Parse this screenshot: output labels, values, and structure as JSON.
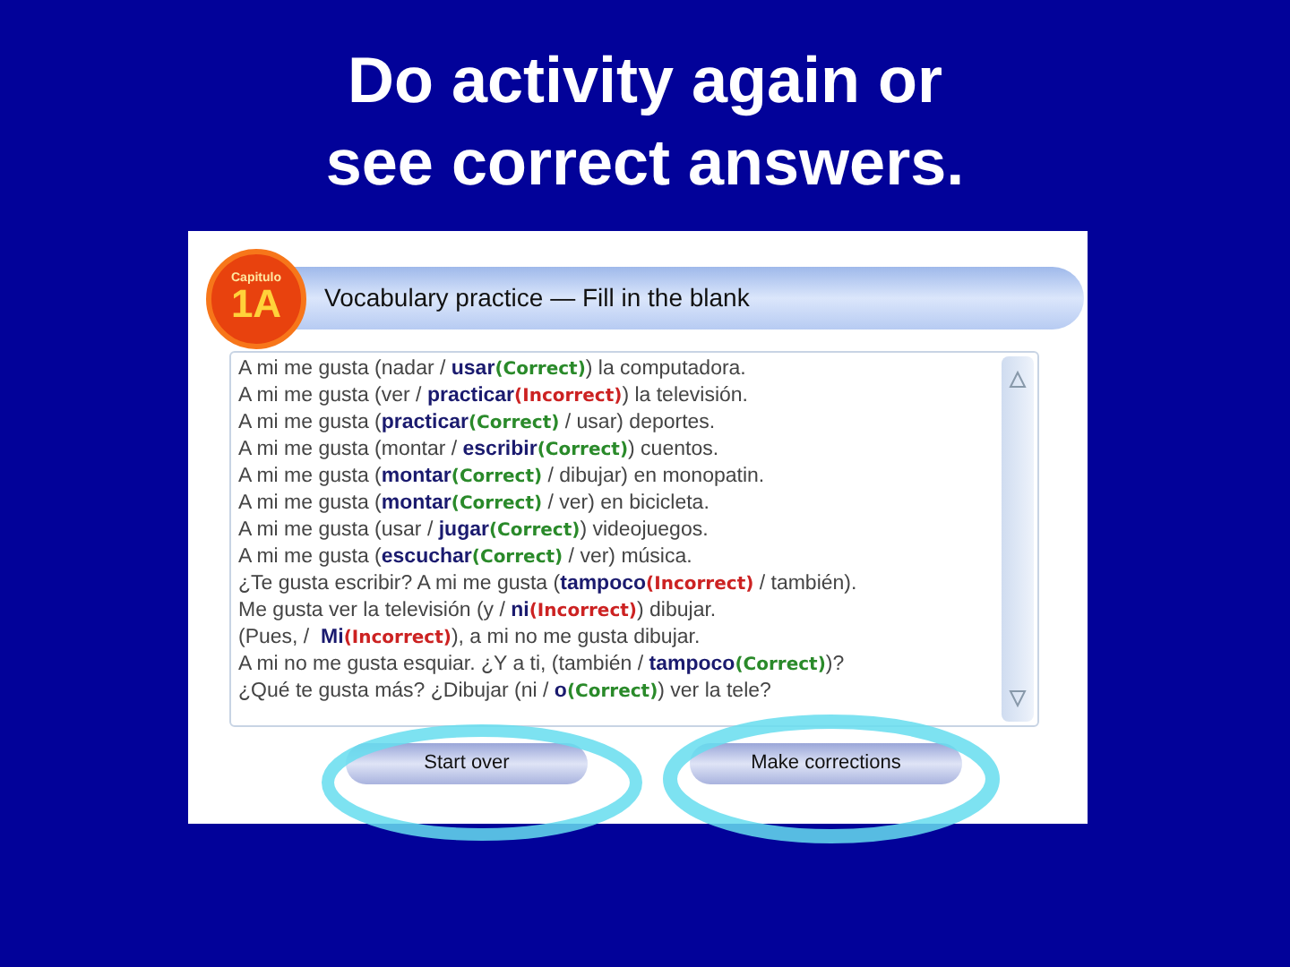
{
  "slide_title": "Do activity again or see correct answers.",
  "activity": {
    "badge": {
      "label": "Capitulo",
      "chapter": "1A"
    },
    "title": "Vocabulary practice — Fill in the blank",
    "lines": [
      [
        {
          "kind": "plain",
          "text": "A mi me gusta (nadar / "
        },
        {
          "kind": "answer",
          "text": "usar"
        },
        {
          "kind": "correct",
          "text": "(Correct)"
        },
        {
          "kind": "plain",
          "text": ") la computadora."
        }
      ],
      [
        {
          "kind": "plain",
          "text": "A mi me gusta (ver / "
        },
        {
          "kind": "answer",
          "text": "practicar"
        },
        {
          "kind": "incorrect",
          "text": "(Incorrect)"
        },
        {
          "kind": "plain",
          "text": ") la televisión."
        }
      ],
      [
        {
          "kind": "plain",
          "text": "A mi me gusta ("
        },
        {
          "kind": "answer",
          "text": "practicar"
        },
        {
          "kind": "correct",
          "text": "(Correct)"
        },
        {
          "kind": "plain",
          "text": " / usar) deportes."
        }
      ],
      [
        {
          "kind": "plain",
          "text": "A mi me gusta (montar / "
        },
        {
          "kind": "answer",
          "text": "escribir"
        },
        {
          "kind": "correct",
          "text": "(Correct)"
        },
        {
          "kind": "plain",
          "text": ") cuentos."
        }
      ],
      [
        {
          "kind": "plain",
          "text": "A mi me gusta ("
        },
        {
          "kind": "answer",
          "text": "montar"
        },
        {
          "kind": "correct",
          "text": "(Correct)"
        },
        {
          "kind": "plain",
          "text": " / dibujar) en monopatin."
        }
      ],
      [
        {
          "kind": "plain",
          "text": "A mi me gusta ("
        },
        {
          "kind": "answer",
          "text": "montar"
        },
        {
          "kind": "correct",
          "text": "(Correct)"
        },
        {
          "kind": "plain",
          "text": " / ver) en bicicleta."
        }
      ],
      [
        {
          "kind": "plain",
          "text": "A mi me gusta (usar / "
        },
        {
          "kind": "answer",
          "text": "jugar"
        },
        {
          "kind": "correct",
          "text": "(Correct)"
        },
        {
          "kind": "plain",
          "text": ") videojuegos."
        }
      ],
      [
        {
          "kind": "plain",
          "text": "A mi me gusta ("
        },
        {
          "kind": "answer",
          "text": "escuchar"
        },
        {
          "kind": "correct",
          "text": "(Correct)"
        },
        {
          "kind": "plain",
          "text": " / ver) música."
        }
      ],
      [
        {
          "kind": "plain",
          "text": "¿Te gusta escribir? A mi me gusta ("
        },
        {
          "kind": "answer",
          "text": "tampoco"
        },
        {
          "kind": "incorrect",
          "text": "(Incorrect)"
        },
        {
          "kind": "plain",
          "text": " / también)."
        }
      ],
      [
        {
          "kind": "plain",
          "text": "Me gusta ver la televisión (y / "
        },
        {
          "kind": "answer",
          "text": "ni"
        },
        {
          "kind": "incorrect",
          "text": "(Incorrect)"
        },
        {
          "kind": "plain",
          "text": ") dibujar."
        }
      ],
      [
        {
          "kind": "plain",
          "text": "(Pues, /  "
        },
        {
          "kind": "answer",
          "text": "Mi"
        },
        {
          "kind": "incorrect",
          "text": "(Incorrect)"
        },
        {
          "kind": "plain",
          "text": "), a mi no me gusta dibujar."
        }
      ],
      [
        {
          "kind": "plain",
          "text": "A mi no me gusta esquiar. ¿Y a ti, (también / "
        },
        {
          "kind": "answer",
          "text": "tampoco"
        },
        {
          "kind": "correct",
          "text": "(Correct)"
        },
        {
          "kind": "plain",
          "text": ")?"
        }
      ],
      [
        {
          "kind": "plain",
          "text": "¿Qué te gusta más? ¿Dibujar (ni / "
        },
        {
          "kind": "answer",
          "text": "o"
        },
        {
          "kind": "correct",
          "text": "(Correct)"
        },
        {
          "kind": "plain",
          "text": ") ver la tele?"
        }
      ]
    ],
    "buttons": [
      "Start over",
      "Make corrections"
    ]
  }
}
